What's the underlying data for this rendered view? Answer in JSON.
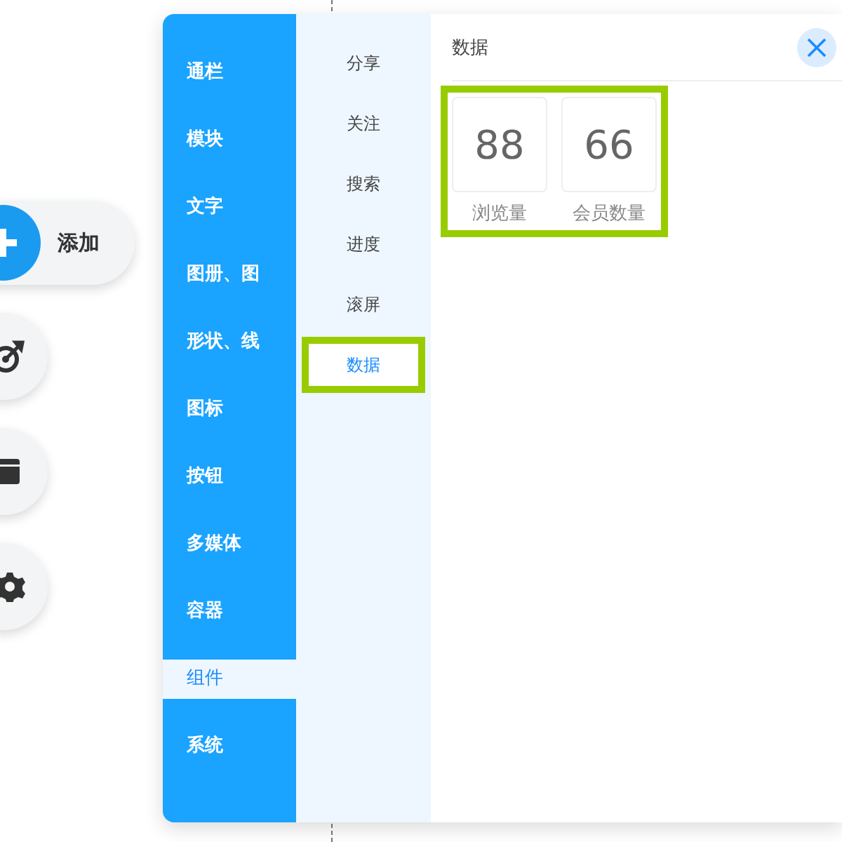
{
  "toolbar": {
    "add_button": "添加"
  },
  "categories": [
    {
      "label": "通栏",
      "selected": false
    },
    {
      "label": "模块",
      "selected": false
    },
    {
      "label": "文字",
      "selected": false
    },
    {
      "label": "图册、图",
      "selected": false
    },
    {
      "label": "形状、线",
      "selected": false
    },
    {
      "label": "图标",
      "selected": false
    },
    {
      "label": "按钮",
      "selected": false
    },
    {
      "label": "多媒体",
      "selected": false
    },
    {
      "label": "容器",
      "selected": false
    },
    {
      "label": "组件",
      "selected": true
    },
    {
      "label": "系统",
      "selected": false
    }
  ],
  "subitems": [
    {
      "label": "分享",
      "selected": false,
      "highlighted": false
    },
    {
      "label": "关注",
      "selected": false,
      "highlighted": false
    },
    {
      "label": "搜索",
      "selected": false,
      "highlighted": false
    },
    {
      "label": "进度",
      "selected": false,
      "highlighted": false
    },
    {
      "label": "滚屏",
      "selected": false,
      "highlighted": false
    },
    {
      "label": "数据",
      "selected": true,
      "highlighted": true
    }
  ],
  "content": {
    "title": "数据",
    "highlighted": true,
    "stats": [
      {
        "value": "88",
        "label": "浏览量"
      },
      {
        "value": "66",
        "label": "会员数量"
      }
    ]
  }
}
